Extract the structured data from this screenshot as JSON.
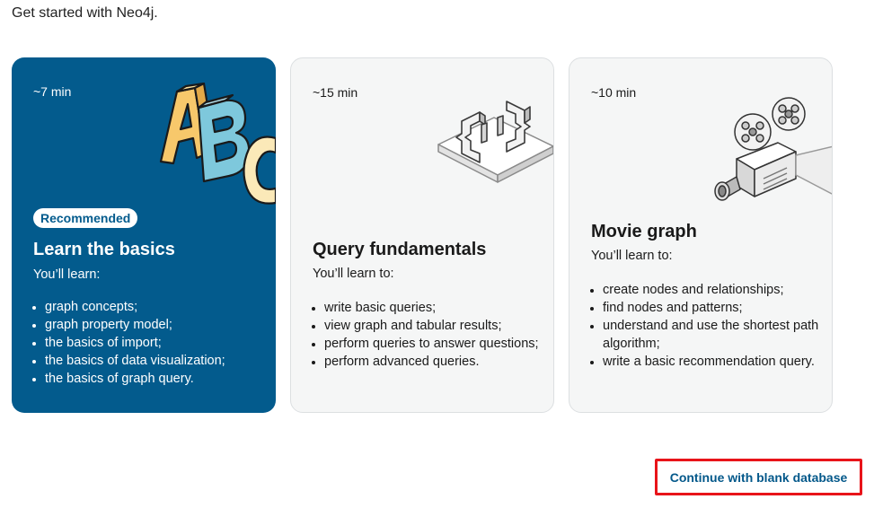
{
  "intro": "Get started with Neo4j.",
  "cards": [
    {
      "duration": "~7 min",
      "badge": "Recommended",
      "title": "Learn the basics",
      "subtitle": "You’ll learn:",
      "items": [
        "graph concepts;",
        "graph property model;",
        "the basics of import;",
        "the basics of data visualization;",
        "the basics of graph query."
      ],
      "icon": "abc-blocks-icon"
    },
    {
      "duration": "~15 min",
      "title": "Query fundamentals",
      "subtitle": "You’ll learn to:",
      "items": [
        "write basic queries;",
        "view graph and tabular results;",
        "perform queries to answer questions;",
        "perform advanced queries."
      ],
      "icon": "curly-braces-icon"
    },
    {
      "duration": "~10 min",
      "title": "Movie graph",
      "subtitle": "You’ll learn to:",
      "items": [
        "create nodes and relationships;",
        "find nodes and patterns;",
        "understand and use the shortest path algorithm;",
        "write a basic recommendation query."
      ],
      "icon": "film-projector-icon"
    }
  ],
  "blank_button": "Continue with blank database",
  "colors": {
    "card_blue": "#035b8d",
    "link_blue": "#03588a",
    "highlight_red": "#e8141a",
    "abc_yellow": "#f7c86b",
    "abc_teal": "#7ec8dc",
    "abc_cream": "#fbe9b8"
  }
}
